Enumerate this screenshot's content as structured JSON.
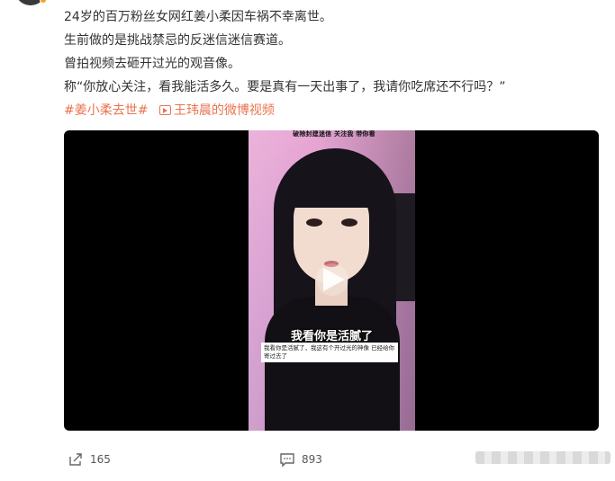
{
  "post": {
    "lines": [
      "24岁的百万粉丝女网红姜小柔因车祸不幸离世。",
      "生前做的是挑战禁忌的反迷信迷信赛道。",
      "曾拍视频去砸开过光的观音像。",
      "称“你放心关注，看我能活多久。要是真有一天出事了，我请你吃席还不行吗？”"
    ],
    "tag": "#姜小柔去世#",
    "video_link": "王玮晨的微博视频"
  },
  "video": {
    "top_caption": "破除封建迷信 关注我 带你看",
    "subtitle": "我看你是活腻了",
    "comment_text": "我看你是活腻了，我这有个开过光的神像 已经给你寄过去了"
  },
  "actions": {
    "share_count": "165",
    "comment_count": "893"
  },
  "colors": {
    "link": "#eb7350",
    "text": "#333333",
    "video_bg": "#000000"
  }
}
